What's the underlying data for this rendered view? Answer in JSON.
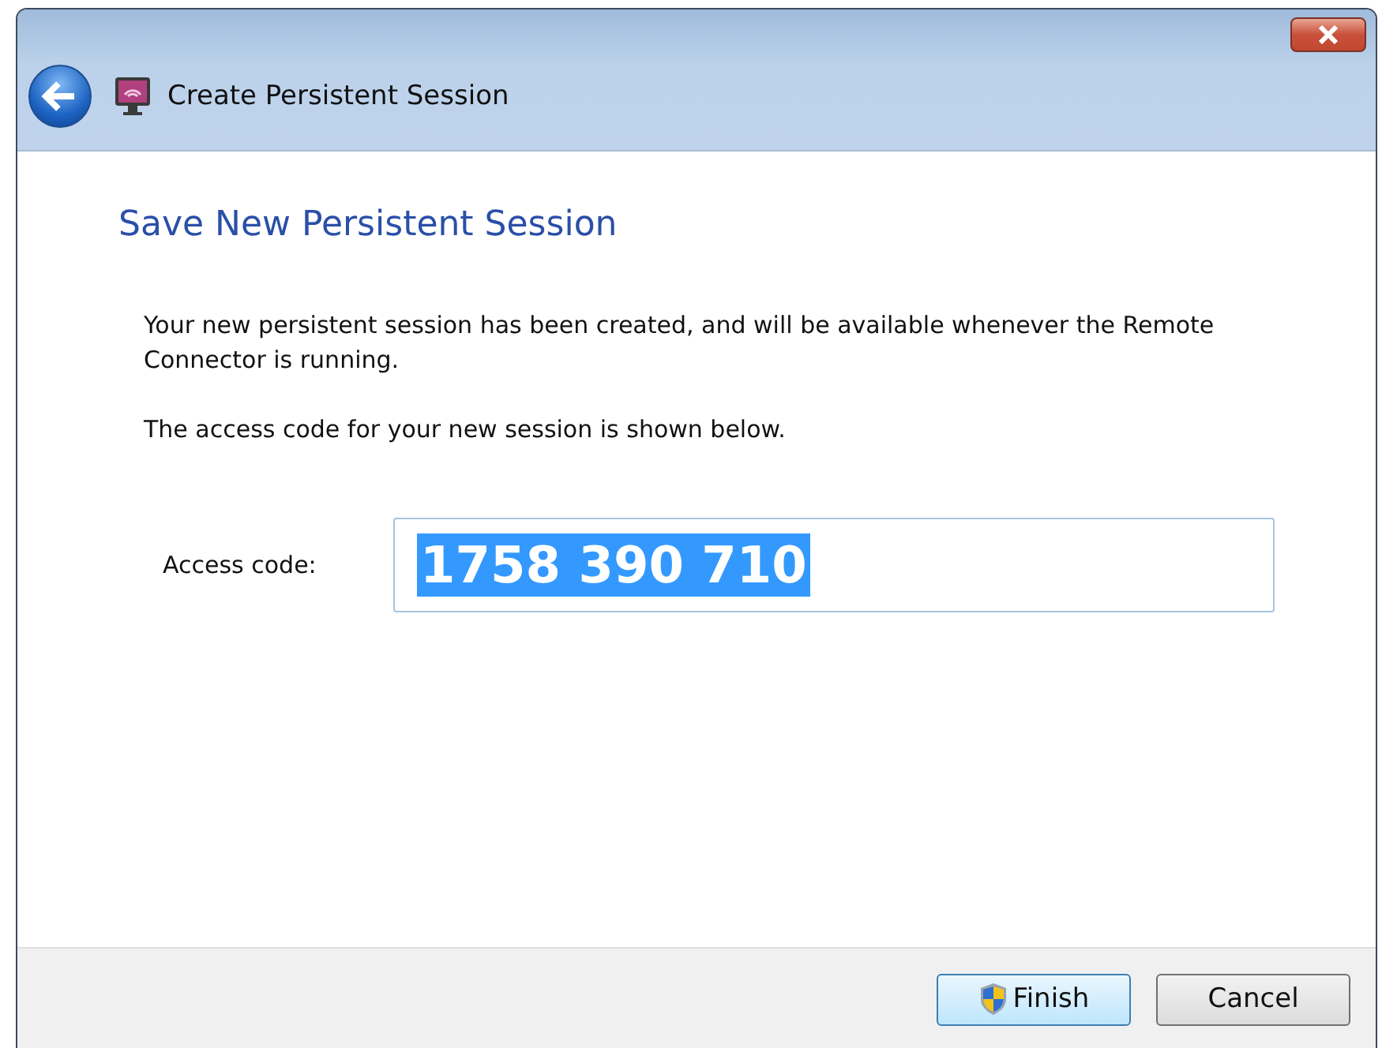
{
  "window": {
    "title": "Create Persistent Session"
  },
  "heading": "Save New Persistent Session",
  "paragraphs": [
    "Your new persistent session has been created, and will be available whenever the Remote Connector is running.",
    "The access code for your new session is shown below."
  ],
  "access_code": {
    "label": "Access code:",
    "value": "1758 390 710",
    "selected": true
  },
  "buttons": [
    {
      "label": "Finish",
      "kind": "shield",
      "default": true
    },
    {
      "label": "Cancel",
      "kind": "plain",
      "default": false
    }
  ]
}
